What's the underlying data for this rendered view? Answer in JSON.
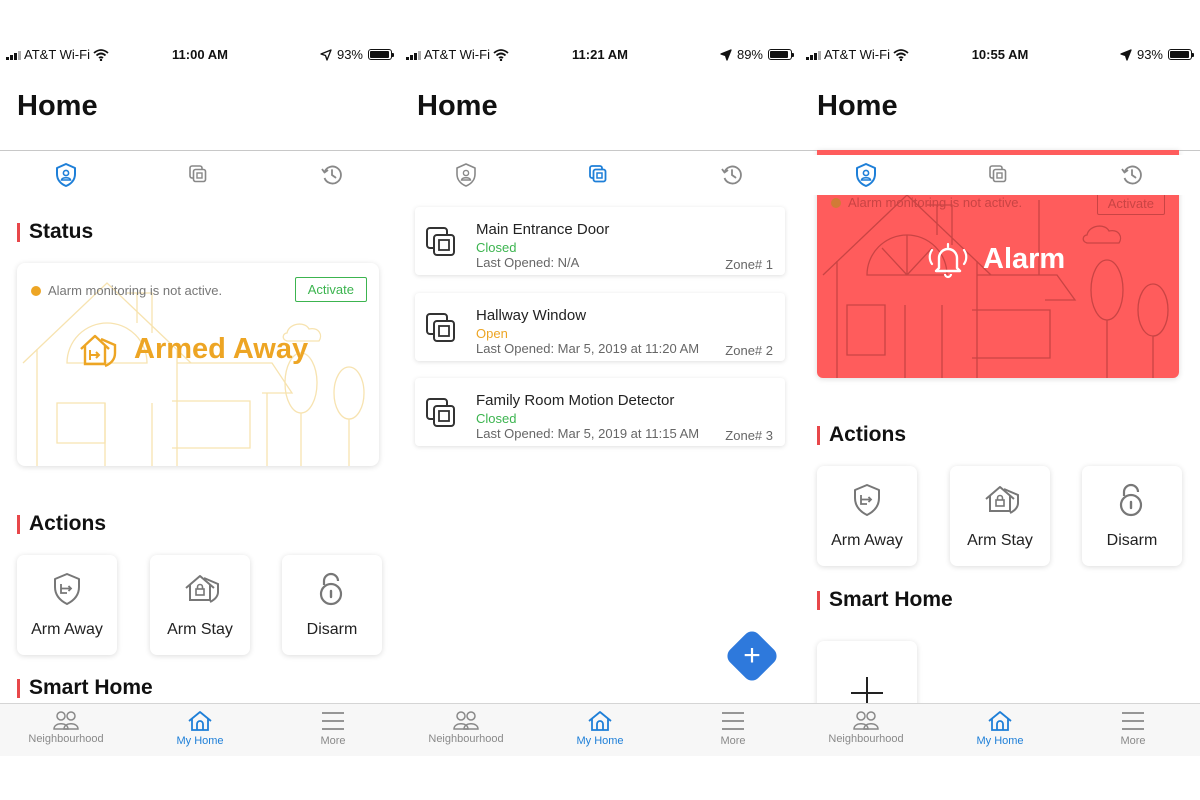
{
  "colors": {
    "accent": "#1e7fd8",
    "alarm": "#ff5c5c",
    "armed": "#eda524",
    "closed": "#3cb44f",
    "open": "#eda524",
    "section_bar": "#e8474a"
  },
  "screens": [
    {
      "status_bar": {
        "carrier": "AT&T Wi-Fi",
        "time": "11:00 AM",
        "battery": "93%"
      },
      "title": "Home",
      "tabs": [
        "shield-tab",
        "zones-tab",
        "history-tab"
      ],
      "status": {
        "heading": "Status",
        "message": "Alarm monitoring is not active.",
        "activate": "Activate",
        "state": "Armed Away"
      },
      "actions": {
        "heading": "Actions",
        "items": [
          {
            "label": "Arm Away"
          },
          {
            "label": "Arm Stay"
          },
          {
            "label": "Disarm"
          }
        ]
      },
      "smart_home": {
        "heading": "Smart Home"
      }
    },
    {
      "status_bar": {
        "carrier": "AT&T Wi-Fi",
        "time": "11:21 AM",
        "battery": "89%"
      },
      "title": "Home",
      "zones": [
        {
          "name": "Main Entrance Door",
          "state": "Closed",
          "last_opened": "Last Opened: N/A",
          "zone": "Zone# 1"
        },
        {
          "name": "Hallway Window",
          "state": "Open",
          "last_opened": "Last Opened: Mar 5, 2019 at 11:20 AM",
          "zone": "Zone# 2"
        },
        {
          "name": "Family Room Motion Detector",
          "state": "Closed",
          "last_opened": "Last Opened: Mar 5, 2019 at 11:15 AM",
          "zone": "Zone# 3"
        }
      ]
    },
    {
      "status_bar": {
        "carrier": "AT&T Wi-Fi",
        "time": "10:55 AM",
        "battery": "93%"
      },
      "title": "Home",
      "status": {
        "message": "Alarm monitoring is not active.",
        "activate": "Activate",
        "state": "Alarm"
      },
      "actions": {
        "heading": "Actions",
        "items": [
          {
            "label": "Arm Away"
          },
          {
            "label": "Arm Stay"
          },
          {
            "label": "Disarm"
          }
        ]
      },
      "smart_home": {
        "heading": "Smart Home"
      }
    }
  ],
  "bottom_nav": [
    {
      "label": "Neighbourhood"
    },
    {
      "label": "My Home"
    },
    {
      "label": "More"
    }
  ]
}
